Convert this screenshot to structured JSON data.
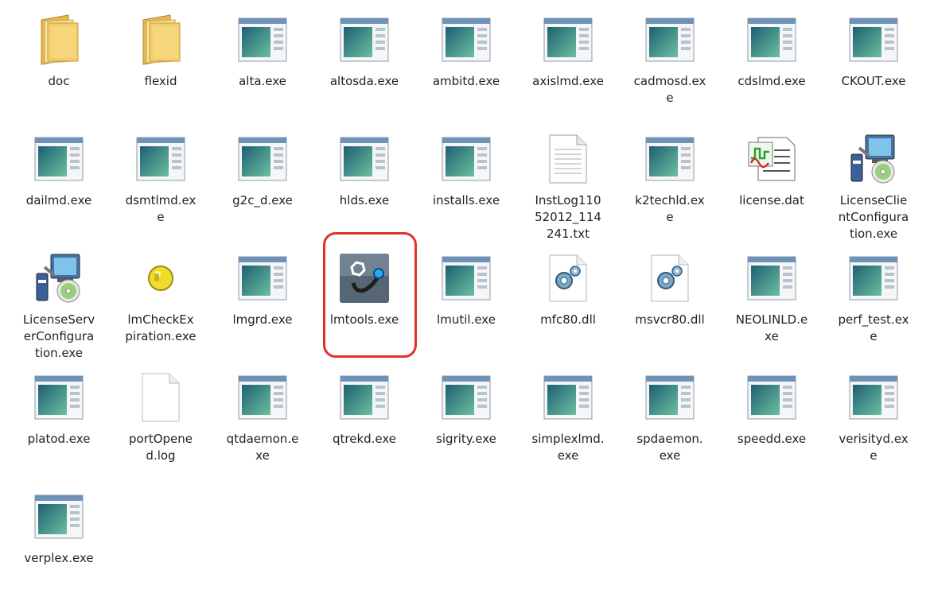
{
  "window": {
    "title": ""
  },
  "files": [
    {
      "label": "doc",
      "icon": "folder-icon"
    },
    {
      "label": "flexid",
      "icon": "folder-icon"
    },
    {
      "label": "alta.exe",
      "icon": "app-window-icon"
    },
    {
      "label": "altosda.exe",
      "icon": "app-window-icon"
    },
    {
      "label": "ambitd.exe",
      "icon": "app-window-icon"
    },
    {
      "label": "axislmd.exe",
      "icon": "app-window-icon"
    },
    {
      "label": "cadmosd.exe",
      "icon": "app-window-icon"
    },
    {
      "label": "cdslmd.exe",
      "icon": "app-window-icon"
    },
    {
      "label": "CKOUT.exe",
      "icon": "app-window-icon"
    },
    {
      "label": "dailmd.exe",
      "icon": "app-window-icon"
    },
    {
      "label": "dsmtlmd.exe",
      "icon": "app-window-icon"
    },
    {
      "label": "g2c_d.exe",
      "icon": "app-window-icon"
    },
    {
      "label": "hlds.exe",
      "icon": "app-window-icon"
    },
    {
      "label": "installs.exe",
      "icon": "app-window-icon"
    },
    {
      "label": "InstLog11052012_114241.txt",
      "icon": "text-document-icon"
    },
    {
      "label": "k2techld.exe",
      "icon": "app-window-icon"
    },
    {
      "label": "license.dat",
      "icon": "license-file-icon"
    },
    {
      "label": "LicenseClientConfiguration.exe",
      "icon": "installer-icon"
    },
    {
      "label": "LicenseServerConfiguration.exe",
      "icon": "installer-icon"
    },
    {
      "label": "lmCheckExpiration.exe",
      "icon": "lock-icon"
    },
    {
      "label": "lmgrd.exe",
      "icon": "app-window-icon"
    },
    {
      "label": "lmtools.exe",
      "icon": "lmtools-icon",
      "highlighted": true
    },
    {
      "label": "lmutil.exe",
      "icon": "app-window-icon"
    },
    {
      "label": "mfc80.dll",
      "icon": "dll-gear-icon"
    },
    {
      "label": "msvcr80.dll",
      "icon": "dll-gear-icon"
    },
    {
      "label": "NEOLINLD.exe",
      "icon": "app-window-icon"
    },
    {
      "label": "perf_test.exe",
      "icon": "app-window-icon"
    },
    {
      "label": "platod.exe",
      "icon": "app-window-icon"
    },
    {
      "label": "portOpened.log",
      "icon": "blank-document-icon"
    },
    {
      "label": "qtdaemon.exe",
      "icon": "app-window-icon"
    },
    {
      "label": "qtrekd.exe",
      "icon": "app-window-icon"
    },
    {
      "label": "sigrity.exe",
      "icon": "app-window-icon"
    },
    {
      "label": "simplexlmd.exe",
      "icon": "app-window-icon"
    },
    {
      "label": "spdaemon.exe",
      "icon": "app-window-icon"
    },
    {
      "label": "speedd.exe",
      "icon": "app-window-icon"
    },
    {
      "label": "verisityd.exe",
      "icon": "app-window-icon"
    },
    {
      "label": "verplex.exe",
      "icon": "app-window-icon"
    }
  ]
}
